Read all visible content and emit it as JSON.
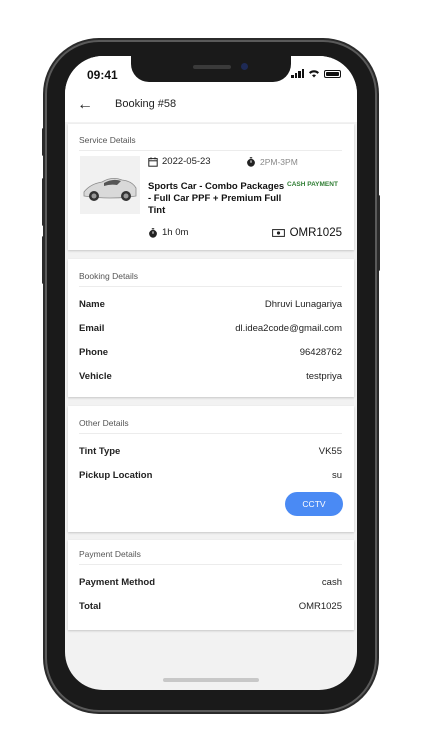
{
  "status_bar": {
    "time": "09:41"
  },
  "app_bar": {
    "title": "Booking #58"
  },
  "service": {
    "section_title": "Service Details",
    "date": "2022-05-23",
    "time_slot": "2PM-3PM",
    "payment_badge": "CASH PAYMENT",
    "name": "Sports Car - Combo Packages - Full Car PPF + Premium Full Tint",
    "duration": "1h 0m",
    "price": "OMR1025"
  },
  "booking": {
    "section_title": "Booking Details",
    "rows": [
      {
        "label": "Name",
        "value": "Dhruvi Lunagariya"
      },
      {
        "label": "Email",
        "value": "dl.idea2code@gmail.com"
      },
      {
        "label": "Phone",
        "value": "96428762"
      },
      {
        "label": "Vehicle",
        "value": "testpriya"
      }
    ]
  },
  "other": {
    "section_title": "Other Details",
    "rows": [
      {
        "label": "Tint Type",
        "value": "VK55"
      },
      {
        "label": "Pickup Location",
        "value": "su"
      }
    ],
    "cctv_label": "CCTV"
  },
  "payment": {
    "section_title": "Payment Details",
    "rows": [
      {
        "label": "Payment Method",
        "value": "cash"
      },
      {
        "label": "Total",
        "value": "OMR1025"
      }
    ]
  },
  "colors": {
    "accent": "#4a8af4",
    "badge_green": "#2e7d32",
    "background": "#f2f2f2"
  }
}
